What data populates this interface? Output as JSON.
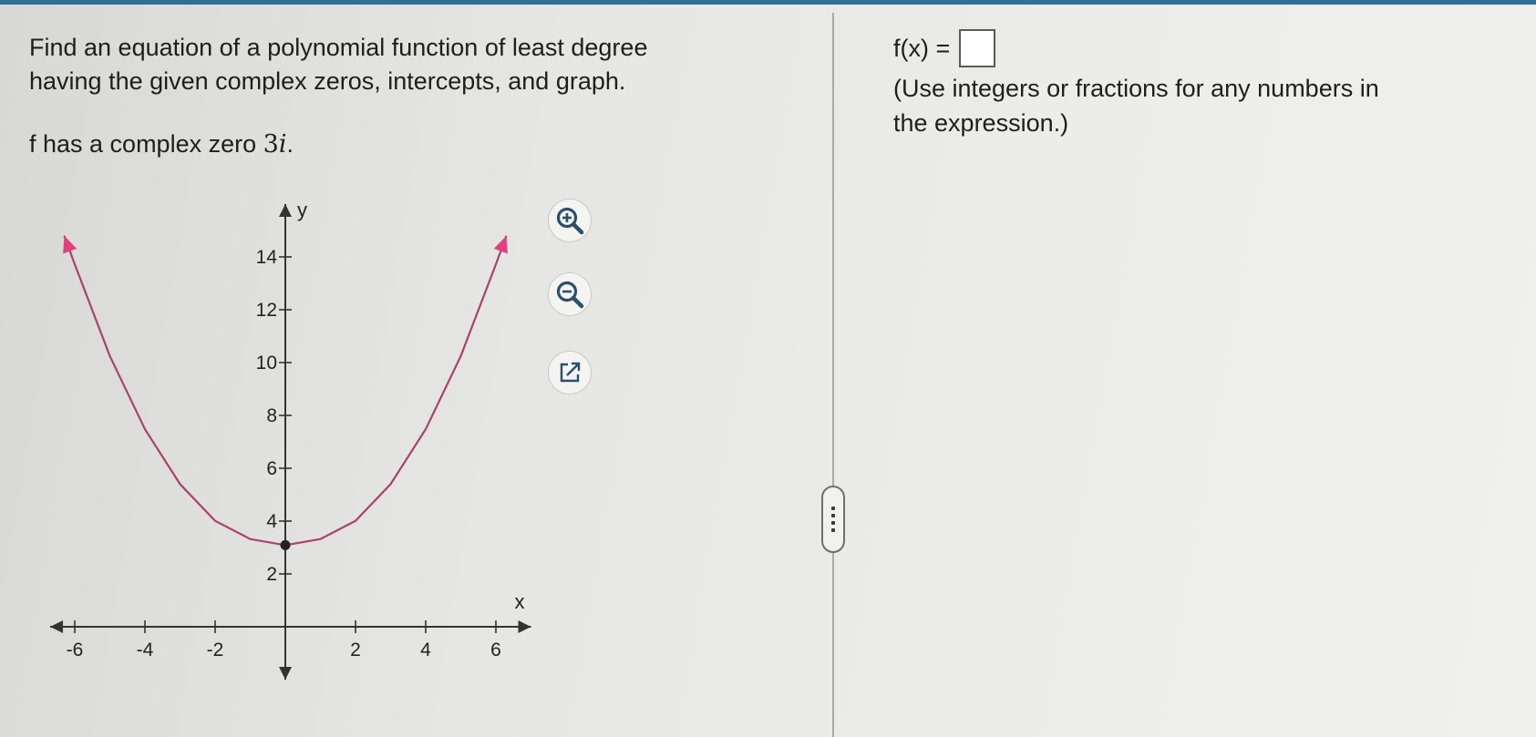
{
  "question": {
    "line1": "Find an equation of a polynomial function of least degree",
    "line2": "having the given complex zeros, intercepts, and graph.",
    "zero_prefix": "f has a complex zero ",
    "zero_value": "3",
    "zero_unit": "i",
    "zero_suffix": "."
  },
  "tools": {
    "zoom_in_icon": "zoom-in-icon",
    "zoom_out_icon": "zoom-out-icon",
    "popout_icon": "external-link-icon"
  },
  "answer": {
    "label": "f(x) =",
    "value": "",
    "instruction_line1": "(Use integers or fractions for any numbers in",
    "instruction_line2": "the expression.)"
  },
  "colors": {
    "curve": "#a8426e",
    "arrow": "#e0407e",
    "axis": "#333333",
    "point": "#222222"
  },
  "chart_data": {
    "type": "line",
    "xlabel": "x",
    "ylabel": "y",
    "xlim": [
      -6.7,
      7.0
    ],
    "ylim": [
      -2.0,
      16.0
    ],
    "x_ticks": [
      -6,
      -4,
      -2,
      2,
      4,
      6
    ],
    "y_ticks": [
      2,
      4,
      6,
      8,
      10,
      12,
      14
    ],
    "series": [
      {
        "x": [
          -6.3,
          -6,
          -5,
          -4,
          -3,
          -2,
          -1,
          0,
          1,
          2,
          3,
          4,
          5,
          6,
          6.3
        ],
        "y": [
          14.8,
          13.72,
          10.25,
          7.48,
          5.4,
          4.01,
          3.32,
          3.09,
          3.32,
          4.01,
          5.4,
          7.48,
          10.25,
          13.72,
          14.8
        ]
      }
    ],
    "points": [
      {
        "x": 0,
        "y": 3.09
      }
    ],
    "grid": false
  }
}
